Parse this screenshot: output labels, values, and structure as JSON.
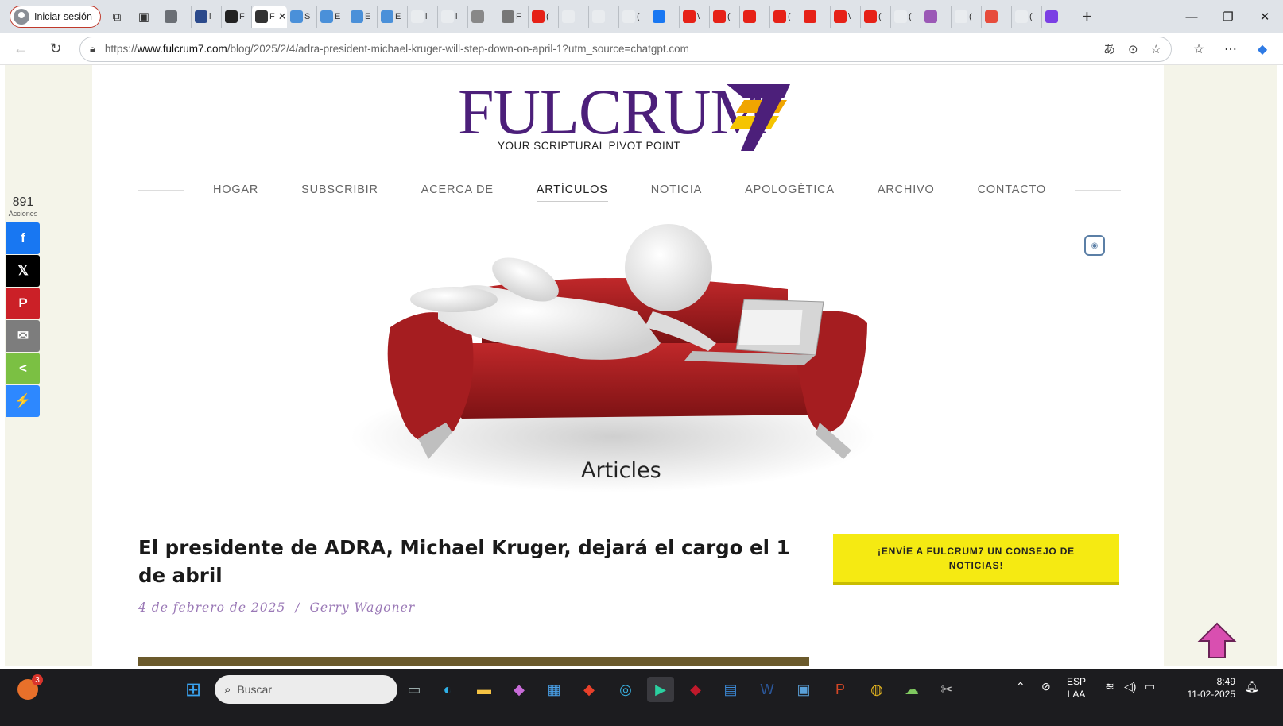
{
  "browser": {
    "signin_label": "Iniciar sesión",
    "tabs": [
      {
        "icon": "workspace-icon",
        "letter": "",
        "color": "#6b6f75"
      },
      {
        "icon": "app-icon",
        "letter": "l",
        "color": "#2b4a8c"
      },
      {
        "icon": "app-icon",
        "letter": "F",
        "color": "#222222"
      },
      {
        "icon": "app-icon",
        "letter": "F",
        "color": "#333333",
        "active": true
      },
      {
        "icon": "un-icon",
        "letter": "S",
        "color": "#4a90d9"
      },
      {
        "icon": "un-icon",
        "letter": "E",
        "color": "#4a90d9"
      },
      {
        "icon": "un-icon",
        "letter": "E",
        "color": "#4a90d9"
      },
      {
        "icon": "un-icon",
        "letter": "E",
        "color": "#4a90d9"
      },
      {
        "icon": "search-icon",
        "letter": "i",
        "color": "#e9ecef"
      },
      {
        "icon": "search-icon",
        "letter": "i",
        "color": "#e9ecef"
      },
      {
        "icon": "doc-icon",
        "letter": "",
        "color": "#888888"
      },
      {
        "icon": "app-icon",
        "letter": "F",
        "color": "#777777"
      },
      {
        "icon": "youtube-icon",
        "letter": "(",
        "color": "#e62117"
      },
      {
        "icon": "search-icon",
        "letter": "",
        "color": "#e9ecef"
      },
      {
        "icon": "search-icon",
        "letter": "",
        "color": "#e9ecef"
      },
      {
        "icon": "search-icon",
        "letter": "(",
        "color": "#e9ecef"
      },
      {
        "icon": "facebook-icon",
        "letter": "",
        "color": "#1877f2"
      },
      {
        "icon": "youtube-icon",
        "letter": "\\",
        "color": "#e62117"
      },
      {
        "icon": "youtube-icon",
        "letter": "(",
        "color": "#e62117"
      },
      {
        "icon": "youtube-icon",
        "letter": "",
        "color": "#e62117"
      },
      {
        "icon": "youtube-icon",
        "letter": "(",
        "color": "#e62117"
      },
      {
        "icon": "youtube-icon",
        "letter": "",
        "color": "#e62117"
      },
      {
        "icon": "youtube-icon",
        "letter": "\\",
        "color": "#e62117"
      },
      {
        "icon": "youtube-icon",
        "letter": "(",
        "color": "#e62117"
      },
      {
        "icon": "search-icon",
        "letter": "(",
        "color": "#e9ecef"
      },
      {
        "icon": "app-icon",
        "letter": "",
        "color": "#9b59b6"
      },
      {
        "icon": "search-icon",
        "letter": "(",
        "color": "#e9ecef"
      },
      {
        "icon": "calendar-icon",
        "letter": "",
        "color": "#e74c3c"
      },
      {
        "icon": "search-icon",
        "letter": "(",
        "color": "#e9ecef"
      },
      {
        "icon": "app-icon",
        "letter": "",
        "color": "#7b3fe4"
      }
    ],
    "url_prefix": "https://",
    "url_domain": "www.fulcrum7.com",
    "url_path": "/blog/2025/2/4/adra-president-michael-kruger-will-step-down-on-april-1?utm_source=chatgpt.com",
    "new_tab_symbol": "+"
  },
  "site": {
    "logo_word": "FULCRUM",
    "logo_tagline": "YOUR SCRIPTURAL PIVOT POINT",
    "nav": [
      {
        "label": "HOGAR",
        "active": false
      },
      {
        "label": "SUBSCRIBIR",
        "active": false
      },
      {
        "label": "ACERCA DE",
        "active": false
      },
      {
        "label": "ARTÍCULOS",
        "active": true
      },
      {
        "label": "NOTICIA",
        "active": false
      },
      {
        "label": "APOLOGÉTICA",
        "active": false
      },
      {
        "label": "ARCHIVO",
        "active": false
      },
      {
        "label": "CONTACTO",
        "active": false
      }
    ],
    "colors": {
      "brand_purple": "#4c1f7a",
      "brand_orange": "#f0a500",
      "meta_purple": "#9a78b6",
      "tip_yellow": "#f5ea12"
    }
  },
  "share": {
    "count": "891",
    "count_label": "Acciones",
    "buttons": [
      {
        "icon": "facebook-icon",
        "glyph": "f",
        "color": "#1877f2"
      },
      {
        "icon": "x-icon",
        "glyph": "𝕏",
        "color": "#000000"
      },
      {
        "icon": "pinterest-icon",
        "glyph": "P",
        "color": "#cb2027"
      },
      {
        "icon": "email-icon",
        "glyph": "✉",
        "color": "#7d7d7d"
      },
      {
        "icon": "share-icon",
        "glyph": "<",
        "color": "#7bc043"
      },
      {
        "icon": "messenger-icon",
        "glyph": "⚡",
        "color": "#2d88ff"
      }
    ]
  },
  "hero": {
    "caption": "Articles"
  },
  "article": {
    "title": "El presidente de ADRA, Michael Kruger, dejará el cargo el 1 de abril",
    "date": "4 de febrero de 2025",
    "separator": "/",
    "author": "Gerry Wagoner"
  },
  "sidebar": {
    "tip_button": "¡ENVÍE A FULCRUM7 UN CONSEJO DE NOTICIAS!"
  },
  "taskbar": {
    "badge_count": "3",
    "search_placeholder": "Buscar",
    "lang_top": "ESP",
    "lang_bottom": "LAA",
    "time": "8:49",
    "date": "11-02-2025"
  }
}
